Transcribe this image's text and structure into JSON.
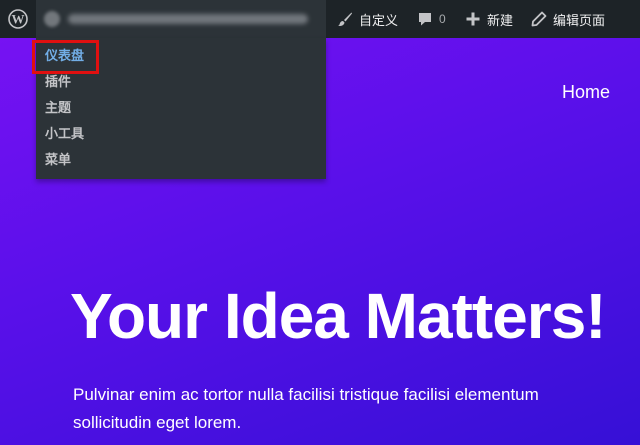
{
  "adminbar": {
    "customize_label": "自定义",
    "comments_count": "0",
    "new_label": "新建",
    "edit_label": "编辑页面"
  },
  "dropdown": {
    "items": [
      {
        "label": "仪表盘",
        "active": true
      },
      {
        "label": "插件"
      },
      {
        "label": "主题"
      },
      {
        "label": "小工具"
      },
      {
        "label": "菜单"
      }
    ]
  },
  "nav": {
    "home_label": "Home"
  },
  "hero": {
    "title": "Your Idea Matters!",
    "text": "Pulvinar enim ac tortor nulla facilisi tristique facilisi elementum sollicitudin eget lorem."
  },
  "colors": {
    "adminbar_bg": "#1d2327",
    "dropdown_bg": "#2c3338",
    "active_link": "#72aee6",
    "highlight_border": "#e01010",
    "hero_gradient_start": "#7a12f4",
    "hero_gradient_end": "#3610d6"
  }
}
